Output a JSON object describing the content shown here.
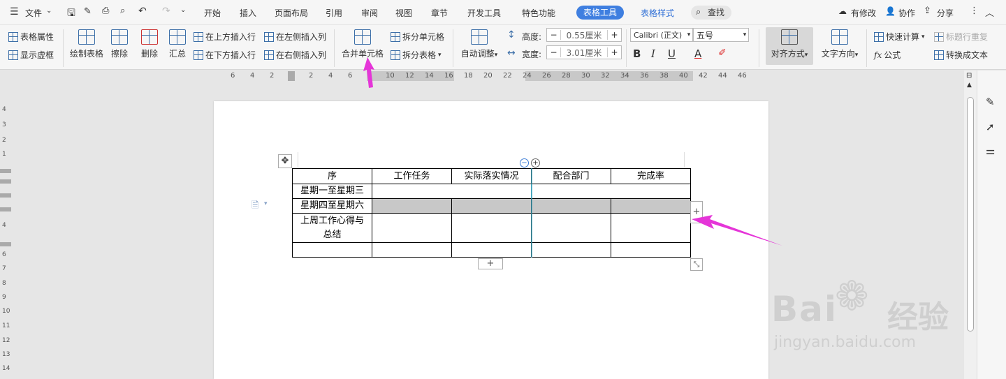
{
  "menubar": {
    "file_label": "文件",
    "tabs": [
      "开始",
      "插入",
      "页面布局",
      "引用",
      "审阅",
      "视图",
      "章节",
      "开发工具",
      "特色功能"
    ],
    "active_tab": "表格工具",
    "style_tab": "表格样式",
    "search_label": "查找",
    "right": {
      "modified": "有修改",
      "collab": "协作",
      "share": "分享"
    }
  },
  "ribbon": {
    "table_props": "表格属性",
    "show_grid": "显示虚框",
    "draw_table": "绘制表格",
    "erase": "擦除",
    "delete": "删除",
    "summary": "汇总",
    "insert_above": "在上方插入行",
    "insert_below": "在下方插入行",
    "insert_left": "在左侧插入列",
    "insert_right": "在右侧插入列",
    "merge_cells": "合并单元格",
    "split_cells": "拆分单元格",
    "split_table": "拆分表格",
    "auto_fit": "自动调整",
    "height_label": "高度:",
    "height_value": "0.55厘米",
    "width_label": "宽度:",
    "width_value": "3.01厘米",
    "font_name": "Calibri (正文)",
    "font_size": "五号",
    "align": "对齐方式",
    "text_dir": "文字方向",
    "quick_calc": "快速计算",
    "title_repeat": "标题行重复",
    "formula": "公式",
    "to_text": "转换成文本",
    "minus": "−",
    "plus": "+"
  },
  "ruler": {
    "h_ticks": [
      "6",
      "4",
      "2",
      "2",
      "4",
      "6",
      "8",
      "10",
      "12",
      "14",
      "16",
      "18",
      "20",
      "22",
      "24",
      "26",
      "28",
      "30",
      "32",
      "34",
      "36",
      "38",
      "40",
      "42",
      "44",
      "46"
    ],
    "v_ticks": [
      "4",
      "3",
      "2",
      "1",
      "4",
      "6",
      "7",
      "8",
      "9",
      "10",
      "11",
      "12",
      "13",
      "14"
    ]
  },
  "table": {
    "header": [
      "序",
      "工作任务",
      "实际落实情况",
      "配合部门",
      "完成率"
    ],
    "row1": "星期一至星期三",
    "row2": "星期四至星期六",
    "row3": "上周工作心得与总结"
  },
  "watermark": {
    "main": "Bai",
    "main2": "经验",
    "url": "jingyan.baidu.com"
  }
}
